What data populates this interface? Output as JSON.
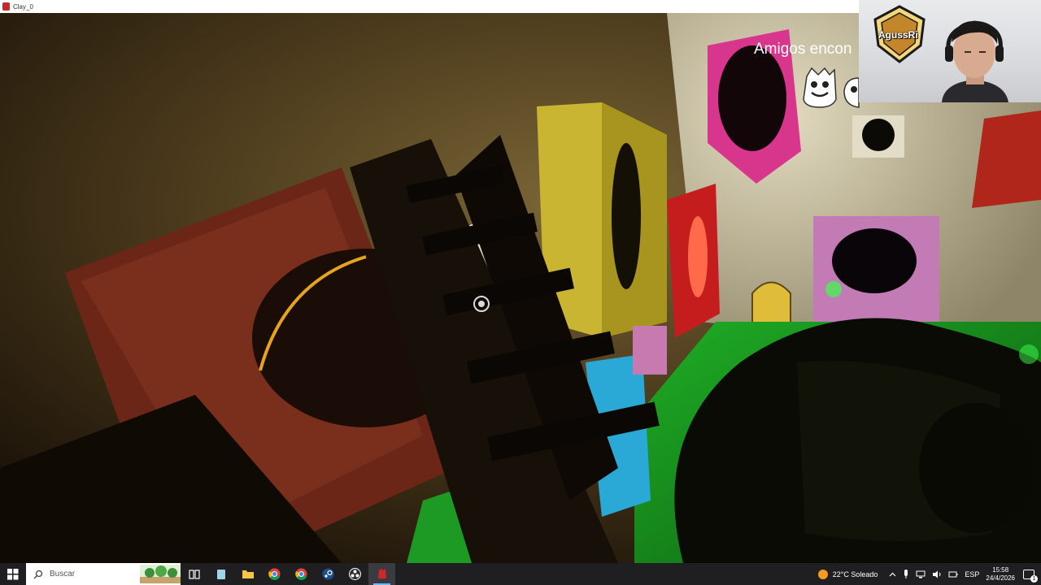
{
  "window": {
    "title": "Clay_0",
    "app_icon": "red-game-icon"
  },
  "game": {
    "hud_text": "Amigos encon",
    "crosshair_icon": "crosshair-icon",
    "friend_icons": [
      "white-clay-character-icon",
      "white-clay-character-icon"
    ]
  },
  "webcam": {
    "logo_text": "AgussRi",
    "logo_icon": "shield-logo-icon"
  },
  "taskbar": {
    "search_placeholder": "Buscar",
    "apps": [
      {
        "name": "task-view-icon",
        "active": false
      },
      {
        "name": "tablet-app-icon",
        "active": false
      },
      {
        "name": "file-explorer-icon",
        "active": false
      },
      {
        "name": "chrome-icon",
        "active": false
      },
      {
        "name": "chrome-profile-icon",
        "active": false
      },
      {
        "name": "steam-icon",
        "active": false
      },
      {
        "name": "obs-icon",
        "active": false
      },
      {
        "name": "clay-game-icon",
        "active": true
      }
    ],
    "weather": "22°C Soleado",
    "language": "ESP",
    "time": "15:58",
    "date": "24/4/2026",
    "notification_count": "1"
  },
  "colors": {
    "accent": "#6db8ff",
    "taskbar_bg": "#1f1f22",
    "hud_text": "#ffffff"
  }
}
